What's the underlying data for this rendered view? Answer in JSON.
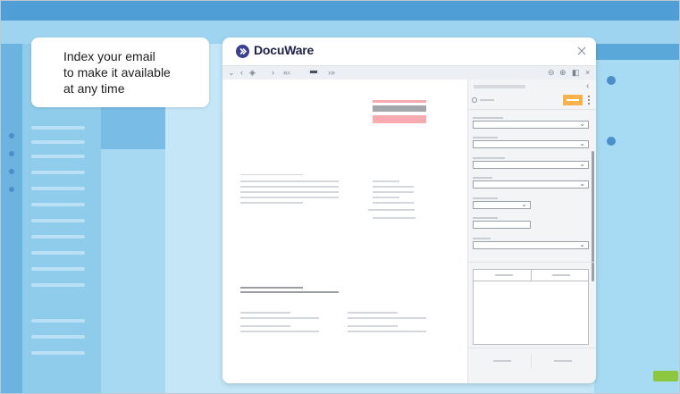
{
  "callout": {
    "text": "Index your email\nto make it available\nat any time"
  },
  "viewer": {
    "brand": "DocuWare",
    "close_icon": "close-icon",
    "toolbar": {
      "collapse": "⌄",
      "prev": "‹",
      "layers": "◈",
      "next": "›",
      "first": "«‹",
      "last": "›»",
      "zoom_out": "⊖",
      "zoom_in": "⊕",
      "panel_toggle": "◧",
      "close": "×"
    }
  },
  "colors": {
    "brand": "#3b3f8f",
    "accent_orange": "#f7b24f",
    "highlight_pink": "#f7aaaf",
    "background_blue": "#7fc6ea"
  }
}
